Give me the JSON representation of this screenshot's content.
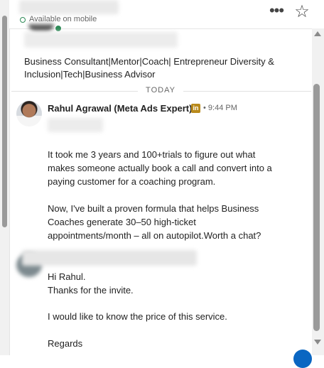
{
  "header": {
    "status": "Available on mobile",
    "more_label": "•••",
    "star_label": "☆"
  },
  "profile": {
    "headline": "Business Consultant|Mentor|Coach| Entrepreneur Diversity & Inclusion|Tech|Business Advisor"
  },
  "divider": {
    "label": "TODAY"
  },
  "message1": {
    "sender": "Rahul Agrawal (Meta Ads Expert)",
    "badge": "in",
    "time": "• 9:44 PM",
    "paragraph1": "It took me 3 years and 100+trials to figure out what makes someone actually book a call and convert into a paying customer for a coaching program.",
    "paragraph2": "Now, I've built a proven formula that helps Business Coaches generate 30–50 high-ticket appointments/month – all on autopilot.Worth a chat?"
  },
  "message2": {
    "line1": "Hi Rahul.",
    "line2": "Thanks for the invite.",
    "line3": "I would like to know the price of this service.",
    "line4": "Regards"
  },
  "colors": {
    "accent": "#0a66c2",
    "online": "#2e8a57",
    "premium_badge": "#b98a1c"
  }
}
